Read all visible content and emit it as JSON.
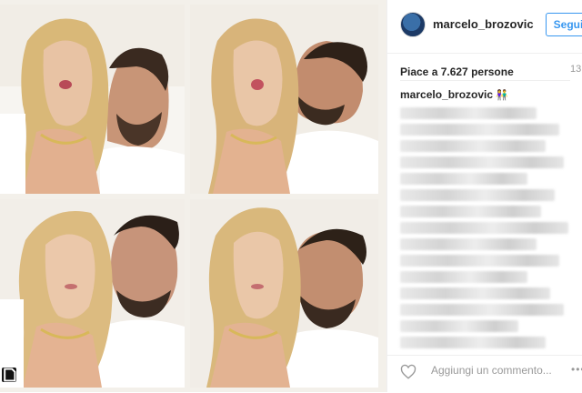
{
  "post": {
    "username": "marcelo_brozovic",
    "follow_label": "Segui",
    "likes_text": "Piace a 7.627 persone",
    "time_label": "13",
    "caption_user": "marcelo_brozovic",
    "caption_emoji": "👫",
    "comment_placeholder": "Aggiungi un commento...",
    "more_label": "•••"
  },
  "icons": {
    "heart": "heart-icon",
    "multi": "multiple-images-icon",
    "avatar": "avatar"
  }
}
